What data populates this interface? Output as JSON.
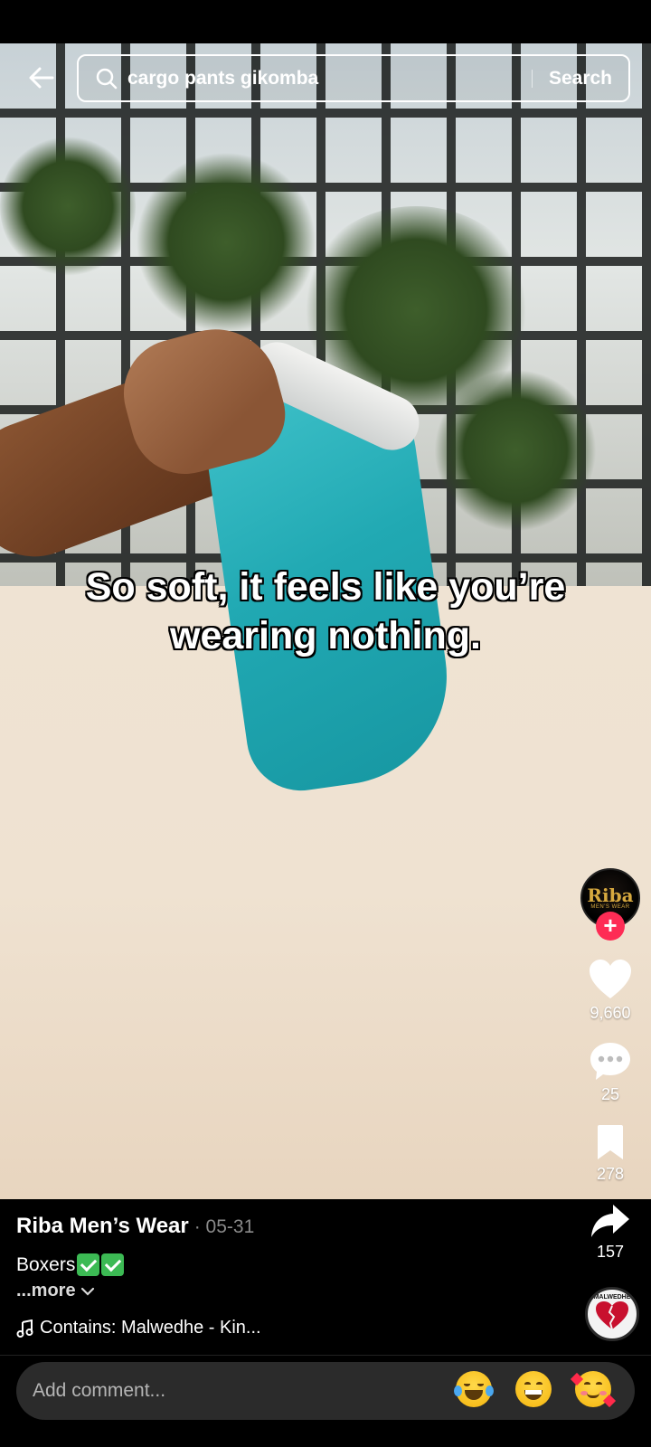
{
  "search": {
    "query": "cargo pants gikomba",
    "button_label": "Search"
  },
  "video": {
    "caption": "So soft, it feels like you’re wearing nothing."
  },
  "creator": {
    "avatar_text": "Riba",
    "avatar_subtext": "MEN'S WEAR"
  },
  "actions": {
    "likes": "9,660",
    "comments": "25",
    "saves": "278",
    "shares": "157"
  },
  "post": {
    "author": "Riba Men’s Wear",
    "date": "· 05-31",
    "description": "Boxers",
    "more_label": "...more",
    "music": "Contains: Malwedhe - Kin..."
  },
  "music_disc": {
    "label": "MALWEDHE"
  },
  "comment_bar": {
    "placeholder": "Add comment..."
  },
  "colors": {
    "follow_red": "#fe2c55",
    "check_green": "#3cba54",
    "avatar_gold": "#d7a93f"
  },
  "icons": [
    "back-arrow-icon",
    "search-icon",
    "heart-icon",
    "comment-icon",
    "bookmark-icon",
    "share-icon",
    "music-note-icon",
    "chevron-down-icon",
    "plus-icon"
  ]
}
